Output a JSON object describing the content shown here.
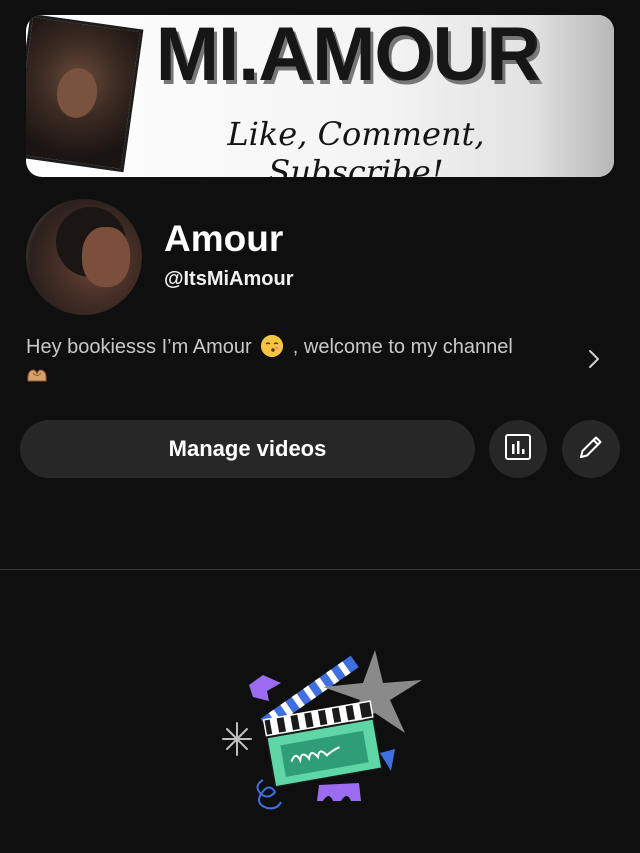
{
  "banner": {
    "title": "MI.AMOUR",
    "subtitle": "Like, Comment, Subscribe!"
  },
  "channel": {
    "name": "Amour",
    "handle": "@ItsMiAmour",
    "description_part1": "Hey bookiesss I’m Amour",
    "description_part2": ", welcome to my channel"
  },
  "actions": {
    "manage_videos_label": "Manage videos"
  },
  "icons": {
    "stats": "bar-chart-icon",
    "edit": "pencil-icon",
    "more": "chevron-right-icon"
  },
  "colors": {
    "background": "#0f0f0f",
    "button_bg": "#272727",
    "text": "#f1f1f1",
    "muted_text": "#c9c9c9"
  }
}
